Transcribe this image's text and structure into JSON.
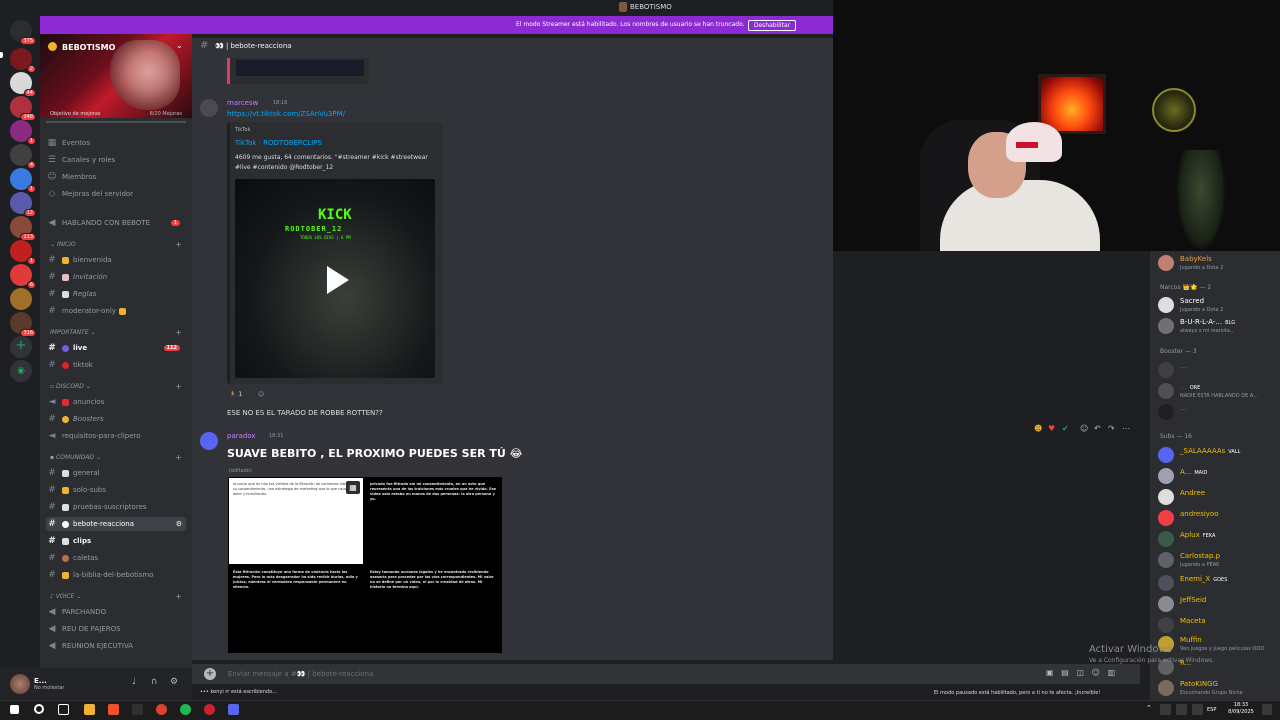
{
  "window": {
    "title": "BEBOTISMO"
  },
  "rail": {
    "badges": [
      "375",
      "2",
      "44",
      "3",
      "248",
      "1",
      "4",
      "1",
      "12",
      "113",
      "1",
      "6",
      "",
      "",
      "316"
    ]
  },
  "server": {
    "name": "BEBOTISMO",
    "boost_goal": "Objetivo de mejoras",
    "boost_count": "8/20 Mejoras"
  },
  "sidebar": {
    "nav": [
      "Eventos",
      "Canales y roles",
      "Miembros",
      "Mejoras del servidor"
    ],
    "hablando": {
      "label": "HABLANDO CON BEBOTE",
      "count": "1"
    },
    "cat_inicio": "INICIO",
    "inicio": [
      "bienvenida",
      "Invitación",
      "Reglas",
      "moderator-only"
    ],
    "cat_importante": "IMPORTANTE",
    "importante": [
      {
        "label": "live",
        "count": "112"
      },
      {
        "label": "tiktok"
      }
    ],
    "cat_discord": "DISCORD",
    "discord": [
      "anuncios",
      "Boosters",
      "requisitos-para-clipero"
    ],
    "cat_comunidad": "COMUNIDAD",
    "comunidad": [
      "general",
      "solo-subs",
      "pruebas-suscriptores",
      "bebote-reacciona",
      "clips",
      "caletas",
      "la-biblia-del-bebotismo"
    ],
    "cat_voice": "VOICE",
    "voice": [
      "PARCHANDO",
      "REU DE PAJEROS",
      "REUNION EJECUTIVA"
    ]
  },
  "user": {
    "name": "E...",
    "status": "No molestar"
  },
  "streamer_bar": {
    "text": "El modo Streamer está habilitado. Los nombres de usuario se han truncado.",
    "button": "Deshabilitar"
  },
  "channel": {
    "name": "bebote-reacciona"
  },
  "messages": [
    {
      "author": "marcesw",
      "time": "18:16",
      "link": "https://vt.tiktok.com/ZSAnVu3PM/",
      "embed": {
        "provider": "TikTok",
        "title": "TikTok · RODTOBERCLIPS",
        "description": "4609 me gusta, 64 comentarios. \"#streamer #kick #streetwear #live #contenido @Rodtober_12",
        "video_brand": "KICK",
        "video_handle": "RODTOBER_12",
        "video_sub": "TODOS LOS DIAS | 6 PM"
      },
      "reaction_count": "1",
      "reply": "ESE NO ES EL TARADO DE ROBBE ROTTEN??"
    },
    {
      "author": "paradox",
      "time": "18:31",
      "text": "SUAVE BEBITO  , EL PROXIMO PUEDES SER TÚ  😂",
      "edited": "(editado)",
      "panes": [
        "Anuncio que mi hija fue víctima de la filtración de contenido íntimo sin su consentimiento, una estrategia de marketing que lo que causó fue dolor y humillación.",
        "privado fue filtrado sin mi consentimiento, en un acto que representa una de las traiciones más crueles que he vivido. Ese video solo estaba en manos de dos personas: la otra persona y yo.",
        "Esta filtración constituye una forma de violencia hacia las mujeres. Pero lo más desgarrador ha sido recibir burlas, odio y juicios, mientras el verdadero responsable permanece en silencio.",
        "Estoy tomando acciones legales y he encontrado recibiendo asesoría para proceder por las vías correspondientes. Mi valor no se define por un video, ni por la crueldad de otros. Mi historia no termina aquí."
      ]
    }
  ],
  "input": {
    "placeholder": "Enviar mensaje a #👀 | bebote-reacciona",
    "typing": "kenyi rr está escribiendo..."
  },
  "members": {
    "top": [
      {
        "name": "BabyKels",
        "sub": "Jugando a Dota 2"
      }
    ],
    "narcos_header": "Narcos 👑🌟 — 2",
    "narcos": [
      {
        "name": "Sacred",
        "sub": "Jugando a Dota 2"
      },
      {
        "name": "B-U-R-L-A-...",
        "tag": "BLG",
        "sub": "always s mi marsita..."
      }
    ],
    "booster_header": "Booster — 3",
    "boosters": [
      {
        "name": "...",
        "sub": ""
      },
      {
        "name": "...",
        "tag": "ORE",
        "sub": "NADIE ESTÁ HABLANDO DE A..."
      },
      {
        "name": "...",
        "sub": ""
      }
    ],
    "subs_header": "Subs — 16",
    "subs": [
      {
        "name": "_SALAAAAAs",
        "tag": "VALL"
      },
      {
        "name": "A...",
        "tag": "MAID"
      },
      {
        "name": "Andree"
      },
      {
        "name": "andresiyoo"
      },
      {
        "name": "Aplux",
        "tag": "FEKA"
      },
      {
        "name": "Carlostap.p",
        "sub": "Jugando a PEAK"
      },
      {
        "name": "Enemi_X",
        "tag": "GOES"
      },
      {
        "name": "JeffSeid"
      },
      {
        "name": "Maceta"
      },
      {
        "name": "Muffin",
        "sub": "Veo juegos y juego películas ODD"
      },
      {
        "name": "R..."
      },
      {
        "name": "PatoKINGG",
        "sub": "Escuchando Grupo Niche"
      }
    ]
  },
  "overlay": {
    "activate": "Activar Windows",
    "activate_sub": "Ve a Configuración para activar Windows.",
    "paused_note": "El modo pausado está habilitado, pero a ti no te afecta. ¡Increíble!"
  },
  "taskbar": {
    "lang": "ESP",
    "time": "18:33",
    "date": "8/09/2025"
  },
  "colors": {
    "accent": "#5865f2",
    "streamer_bar": "#8c2bd4",
    "link": "#00a8fc",
    "kick_green": "#53fc18"
  }
}
